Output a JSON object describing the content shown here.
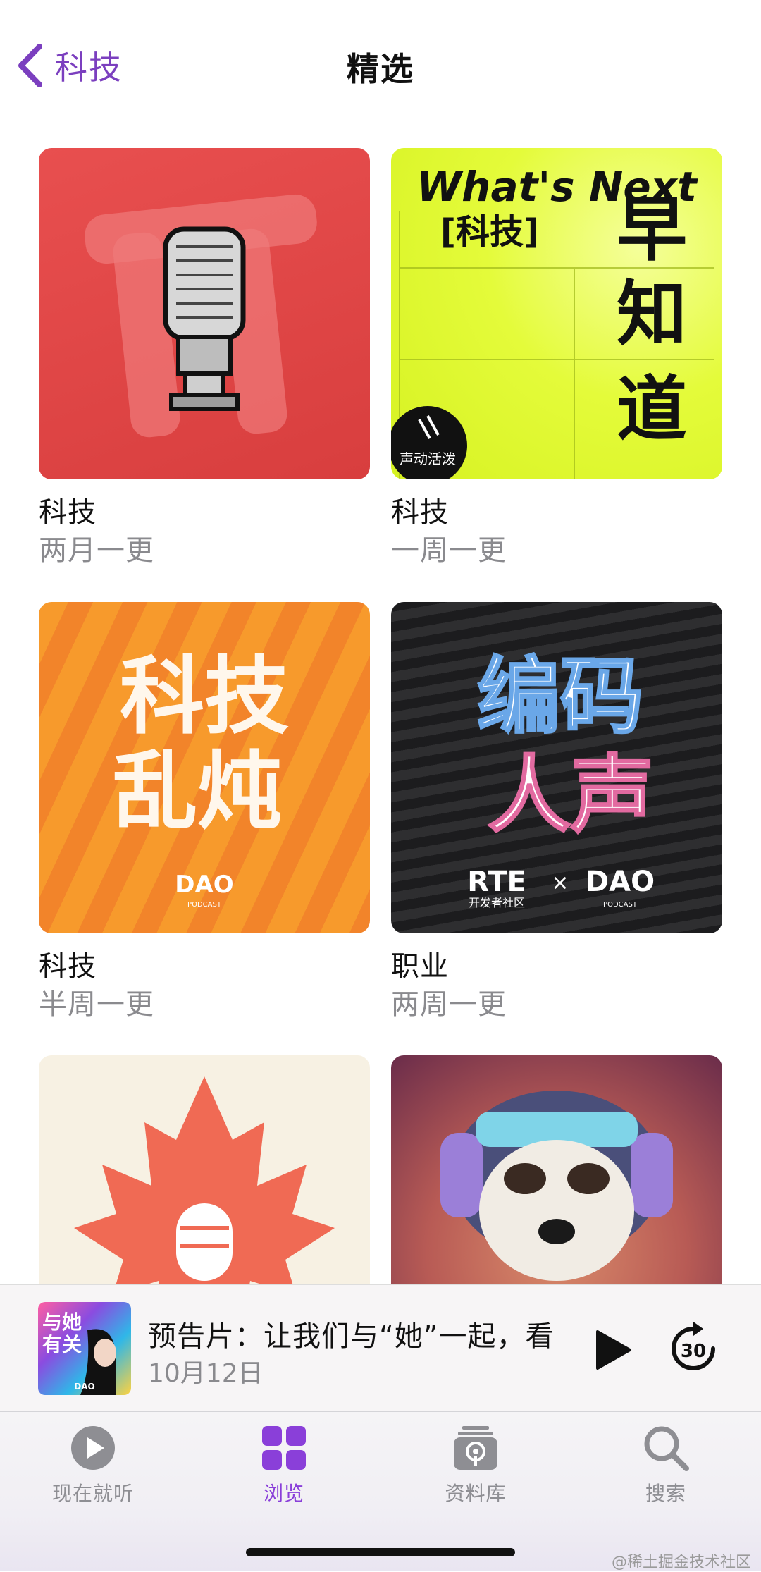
{
  "nav": {
    "back_label": "科技",
    "title": "精选"
  },
  "podcasts": [
    {
      "title": "科技",
      "frequency": "两月一更"
    },
    {
      "title": "科技",
      "frequency": "一周一更",
      "art_text": [
        "What's Next",
        "[科技]",
        "早",
        "知",
        "道"
      ],
      "badge": "声动活泼"
    },
    {
      "title": "科技",
      "frequency": "半周一更",
      "art_text": [
        "科技",
        "乱炖",
        "DAO",
        "PODCAST"
      ]
    },
    {
      "title": "职业",
      "frequency": "两周一更",
      "art_text": [
        "编码",
        "人声",
        "RTE",
        "开发者社区",
        "×",
        "DAO",
        "PODCAST"
      ]
    }
  ],
  "now_playing": {
    "title": "预告片：让我们与“她”一起，看",
    "date": "10月12日",
    "art_text": [
      "与她",
      "有关",
      "DAO"
    ],
    "skip_seconds": "30"
  },
  "tabs": [
    {
      "label": "现在就听",
      "icon": "play-circle-icon"
    },
    {
      "label": "浏览",
      "icon": "grid-icon",
      "active": true
    },
    {
      "label": "资料库",
      "icon": "library-icon"
    },
    {
      "label": "搜索",
      "icon": "search-icon"
    }
  ],
  "watermark": "@稀土掘金技术社区",
  "colors": {
    "accent": "#8a3fd9",
    "back": "#7b3fbf",
    "secondary": "#8a8a8e"
  }
}
